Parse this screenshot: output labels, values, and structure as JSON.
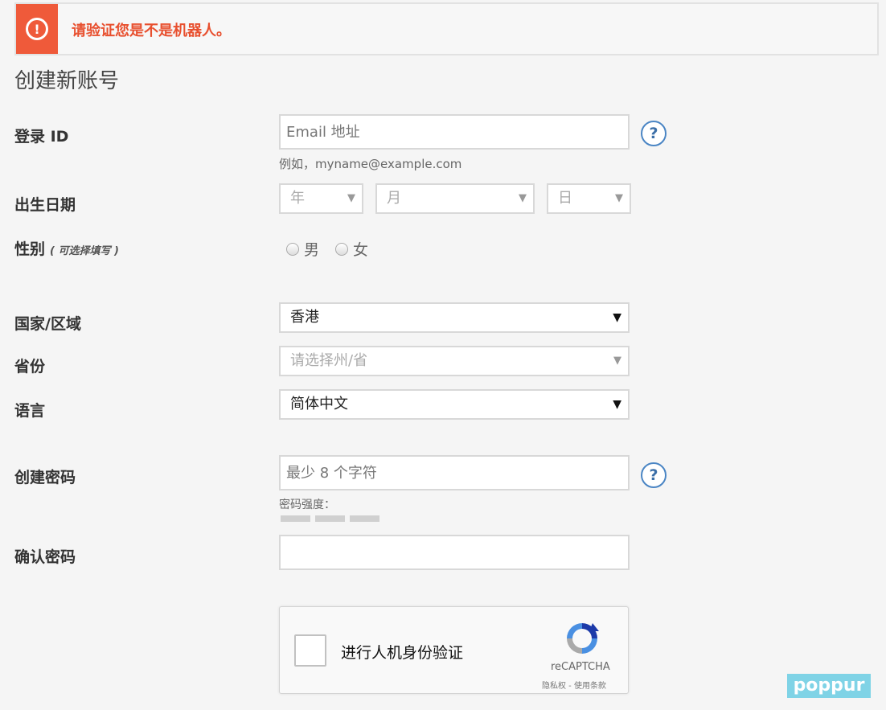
{
  "alert": {
    "message": "请验证您是不是机器人。",
    "icon": "exclamation-circle-icon",
    "color": "#ef5a3a"
  },
  "page_title": "创建新账号",
  "login_id": {
    "label": "登录 ID",
    "placeholder": "Email 地址",
    "hint": "例如，myname@example.com",
    "help": "?"
  },
  "birthdate": {
    "label": "出生日期",
    "year": "年",
    "month": "月",
    "day": "日"
  },
  "gender": {
    "label": "性别",
    "optional": "( 可选择填写 )",
    "male": "男",
    "female": "女"
  },
  "country": {
    "label": "国家/区域",
    "value": "香港"
  },
  "province": {
    "label": "省份",
    "placeholder": "请选择州/省"
  },
  "language": {
    "label": "语言",
    "value": "简体中文"
  },
  "password": {
    "label": "创建密码",
    "placeholder": "最少 8 个字符",
    "strength_label": "密码强度：",
    "help": "?"
  },
  "confirm_password": {
    "label": "确认密码",
    "value": ""
  },
  "captcha": {
    "label": "进行人机身份验证",
    "brand": "reCAPTCHA",
    "terms": "隐私权 - 使用条款"
  },
  "watermark": "poppur"
}
